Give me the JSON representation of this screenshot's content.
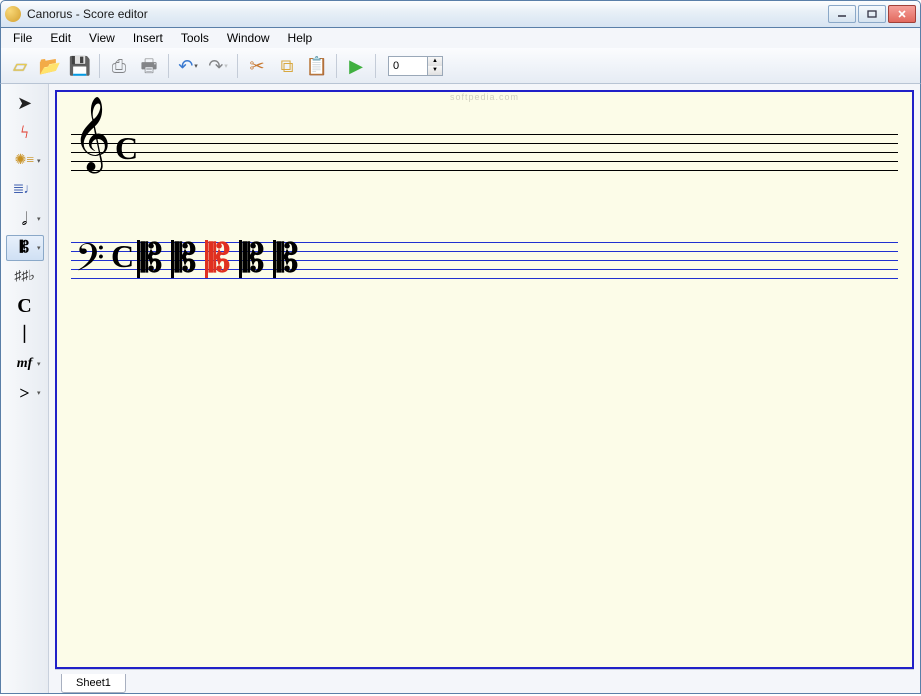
{
  "window": {
    "title": "Canorus - Score editor"
  },
  "menu": {
    "file": "File",
    "edit": "Edit",
    "view": "View",
    "insert": "Insert",
    "tools": "Tools",
    "window": "Window",
    "help": "Help"
  },
  "toolbar": {
    "new": "new-document",
    "open": "open",
    "save": "save",
    "export_pdf": "pdf-export",
    "print": "print",
    "undo": "undo",
    "redo": "redo",
    "cut": "cut",
    "copy": "copy",
    "paste": "paste",
    "play": "play",
    "spin_value": "0"
  },
  "side": {
    "select": "select-tool",
    "erase": "erase-tool",
    "context": "context-tool",
    "staff": "staff-tool",
    "note": "note-duration-tool",
    "clef": "clef-tool",
    "accidental": "accidental-tool",
    "timesig": "time-signature-tool",
    "barline": "barline-tool",
    "dynamic": "dynamic-tool",
    "accent": "accent-tool"
  },
  "sheet": {
    "tab": "Sheet1",
    "watermark": "softpedia.com",
    "staves": [
      {
        "clef": "treble",
        "time": "C",
        "selected": false
      },
      {
        "clef": "bass",
        "time": "C",
        "selected": true,
        "clef_sequence": [
          "alto",
          "alto",
          "alto-red",
          "alto",
          "alto"
        ]
      }
    ]
  }
}
